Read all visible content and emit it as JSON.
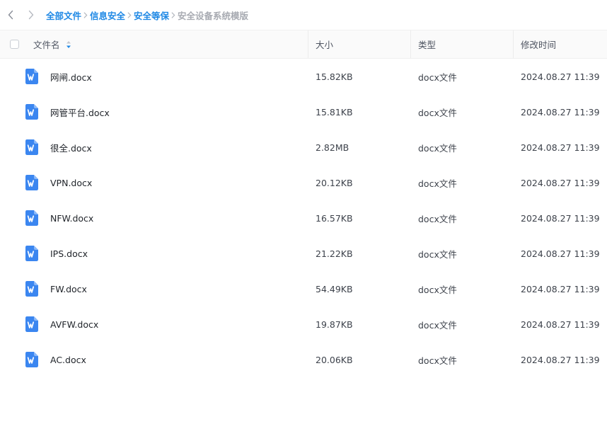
{
  "nav": {
    "back_icon": "chevron-left-icon",
    "forward_icon": "chevron-right-icon"
  },
  "breadcrumb": {
    "items": [
      "全部文件",
      "信息安全",
      "安全等保"
    ],
    "current": "安全设备系统模版",
    "link_color": "#1e88e5",
    "current_color": "#a8abb2"
  },
  "table": {
    "headers": {
      "name": "文件名",
      "size": "大小",
      "type": "类型",
      "modified": "修改时间"
    },
    "sort_icon": "sort-arrows-icon",
    "rows": [
      {
        "name": "网闸.docx",
        "size": "15.82KB",
        "type": "docx文件",
        "modified": "2024.08.27 11:39"
      },
      {
        "name": "网管平台.docx",
        "size": "15.81KB",
        "type": "docx文件",
        "modified": "2024.08.27 11:39"
      },
      {
        "name": "很全.docx",
        "size": "2.82MB",
        "type": "docx文件",
        "modified": "2024.08.27 11:39"
      },
      {
        "name": "VPN.docx",
        "size": "20.12KB",
        "type": "docx文件",
        "modified": "2024.08.27 11:39"
      },
      {
        "name": "NFW.docx",
        "size": "16.57KB",
        "type": "docx文件",
        "modified": "2024.08.27 11:39"
      },
      {
        "name": "IPS.docx",
        "size": "21.22KB",
        "type": "docx文件",
        "modified": "2024.08.27 11:39"
      },
      {
        "name": "FW.docx",
        "size": "54.49KB",
        "type": "docx文件",
        "modified": "2024.08.27 11:39"
      },
      {
        "name": "AVFW.docx",
        "size": "19.87KB",
        "type": "docx文件",
        "modified": "2024.08.27 11:39"
      },
      {
        "name": "AC.docx",
        "size": "20.06KB",
        "type": "docx文件",
        "modified": "2024.08.27 11:39"
      }
    ],
    "file_icon": "word-document-icon",
    "file_icon_color": "#3b86f0"
  }
}
